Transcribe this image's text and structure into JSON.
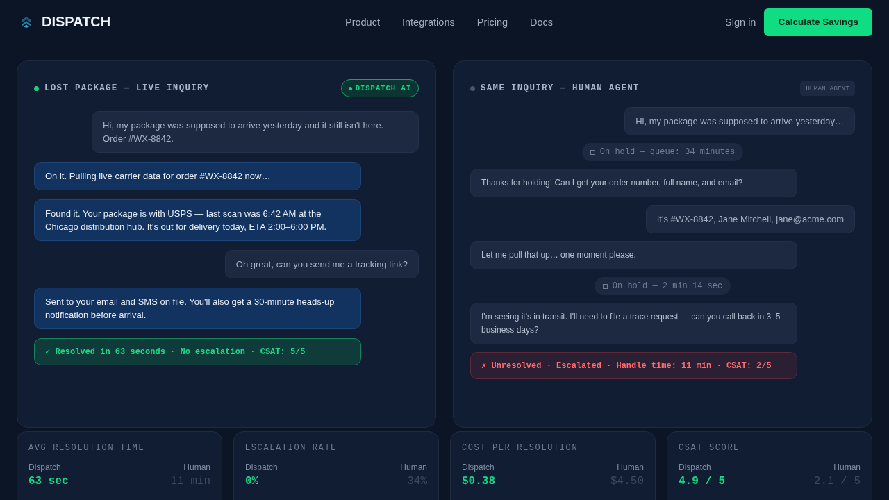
{
  "nav": {
    "brand": "DISPATCH",
    "links": [
      "Product",
      "Integrations",
      "Pricing",
      "Docs"
    ],
    "sign_in": "Sign in",
    "cta": "Calculate Savings"
  },
  "panels": [
    {
      "title": "LOST PACKAGE — LIVE INQUIRY",
      "badge": "DISPATCH AI",
      "kind": "ai",
      "messages": [
        {
          "kind": "user",
          "text": "Hi, my package was supposed to arrive yesterday and it still isn't here. Order #WX-8842."
        },
        {
          "kind": "agent",
          "text": "On it. Pulling live carrier data for order #WX-8842 now…"
        },
        {
          "kind": "agent",
          "text": "Found it. Your package is with USPS — last scan was 6:42 AM at the Chicago distribution hub. It's out for delivery today, ETA 2:00–6:00 PM."
        },
        {
          "kind": "user",
          "text": "Oh great, can you send me a tracking link?"
        },
        {
          "kind": "agent",
          "text": "Sent to your email and SMS on file. You'll also get a 30-minute heads-up notification before arrival."
        },
        {
          "kind": "success",
          "text": "✓ Resolved in 63 seconds · No escalation · CSAT: 5/5"
        }
      ]
    },
    {
      "title": "SAME INQUIRY — HUMAN AGENT",
      "badge": "HUMAN AGENT",
      "kind": "human",
      "messages": [
        {
          "kind": "user",
          "text": "Hi, my package was supposed to arrive yesterday…"
        },
        {
          "kind": "hold",
          "text": "On hold — queue: 34 minutes"
        },
        {
          "kind": "agent",
          "text": "Thanks for holding! Can I get your order number, full name, and email?"
        },
        {
          "kind": "user",
          "text": "It's #WX-8842, Jane Mitchell, jane@acme.com"
        },
        {
          "kind": "agent",
          "text": "Let me pull that up… one moment please."
        },
        {
          "kind": "hold",
          "text": "On hold — 2 min 14 sec"
        },
        {
          "kind": "agent",
          "text": "I'm seeing it's in transit. I'll need to file a trace request — can you call back in 3–5 business days?"
        },
        {
          "kind": "failure",
          "text": "✗ Unresolved · Escalated · Handle time: 11 min · CSAT: 2/5"
        }
      ]
    }
  ],
  "stats": [
    {
      "label": "AVG RESOLUTION TIME",
      "left_label": "Dispatch",
      "left_value": "63 sec",
      "right_label": "Human",
      "right_value": "11 min"
    },
    {
      "label": "ESCALATION RATE",
      "left_label": "Dispatch",
      "left_value": "0%",
      "right_label": "Human",
      "right_value": "34%"
    },
    {
      "label": "COST PER RESOLUTION",
      "left_label": "Dispatch",
      "left_value": "$0.38",
      "right_label": "Human",
      "right_value": "$4.50"
    },
    {
      "label": "CSAT SCORE",
      "left_label": "Dispatch",
      "left_value": "4.9 / 5",
      "right_label": "Human",
      "right_value": "2.1 / 5"
    }
  ]
}
